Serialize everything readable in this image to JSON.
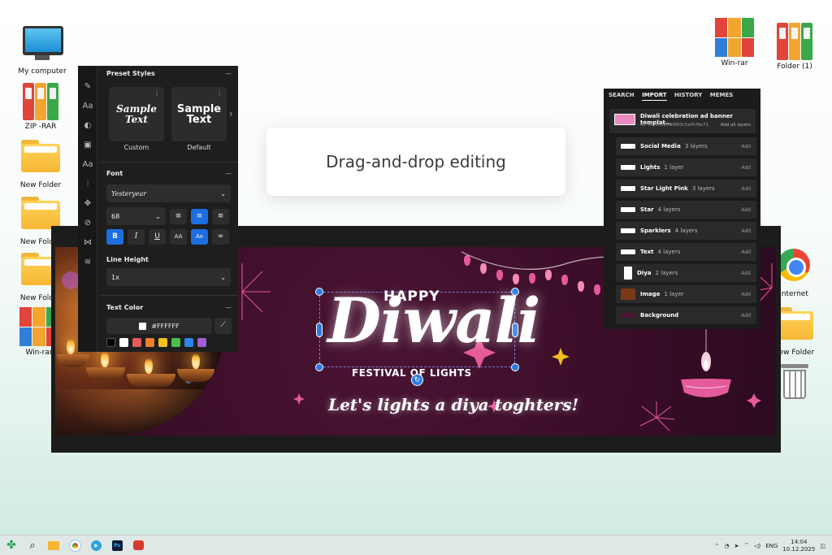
{
  "desktop": {
    "icons_left": [
      {
        "label": "My computer"
      },
      {
        "label": "ZIP -RAR"
      },
      {
        "label": "New Folder"
      },
      {
        "label": "New Folder"
      },
      {
        "label": "New Folder"
      },
      {
        "label": "Win-rar"
      }
    ],
    "icons_right": [
      {
        "label": "Win-rar"
      },
      {
        "label": "Folder (1)"
      },
      {
        "label": "Internet"
      },
      {
        "label": "New Folder"
      }
    ]
  },
  "callout": {
    "text": "Drag-and-drop editing"
  },
  "tool_panel": {
    "preset_styles": {
      "title": "Preset Styles",
      "items": [
        {
          "preview": "Sample Text",
          "label": "Custom"
        },
        {
          "preview": "Sample Text",
          "label": "Default"
        }
      ]
    },
    "font": {
      "title": "Font",
      "family": "Yesteryear",
      "size": "68",
      "case_upper": "AA",
      "case_title": "Ao",
      "bold": "B",
      "italic": "I",
      "underline": "U"
    },
    "line_height": {
      "title": "Line Height",
      "value": "1x"
    },
    "text_color": {
      "title": "Text Color",
      "hex": "#FFFFFF",
      "swatches": [
        "#000000",
        "#ffffff",
        "#e45a5a",
        "#f07f2e",
        "#f2c01f",
        "#4cbe4c",
        "#2a85e6",
        "#a35cd8"
      ]
    }
  },
  "banner": {
    "happy": "HAPPY",
    "title": "Diwali",
    "subtitle": "FESTIVAL OF LIGHTS",
    "tagline": "Let's lights a diya toghters!"
  },
  "layers_panel": {
    "tabs": [
      "SEARCH",
      "IMPORT",
      "HISTORY",
      "MEMES"
    ],
    "active_tab": "IMPORT",
    "template": {
      "name": "Diwali celebration ad banner templat...",
      "id": "ID: 68f96125af983c5affcf6e71",
      "add_all": "Add all layers"
    },
    "add_label": "Add",
    "rows": [
      {
        "name": "Social Media",
        "count": "3 layers"
      },
      {
        "name": "Lights",
        "count": "1 layer"
      },
      {
        "name": "Star Light Pink",
        "count": "3 layers"
      },
      {
        "name": "Star",
        "count": "4 layers"
      },
      {
        "name": "Sparklers",
        "count": "4 layers"
      },
      {
        "name": "Text",
        "count": "4 layers"
      },
      {
        "name": "Diya",
        "count": "2 layers"
      },
      {
        "name": "Image",
        "count": "1 layer"
      },
      {
        "name": "Background",
        "count": ""
      }
    ]
  },
  "taskbar": {
    "lang": "ENG",
    "time": "14:04",
    "date": "10.12.2025"
  },
  "colors": {
    "accent": "#1d6fe0",
    "banner_bg": "#3a0d28",
    "pink": "#e55a9a"
  }
}
